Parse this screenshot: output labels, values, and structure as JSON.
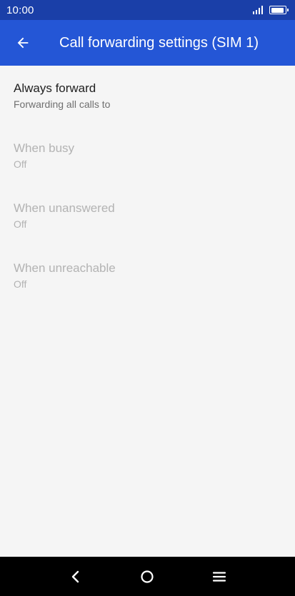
{
  "status_bar": {
    "time": "10:00",
    "icons": [
      "signal-icon",
      "battery-icon"
    ],
    "battery_level": 0.9
  },
  "app_bar": {
    "title": "Call forwarding settings (SIM 1)",
    "back_icon": "arrow-back-icon",
    "background_color": "#2456d6"
  },
  "settings": [
    {
      "title": "Always forward",
      "summary": "Forwarding all calls to",
      "enabled": true
    },
    {
      "title": "When busy",
      "summary": "Off",
      "enabled": false
    },
    {
      "title": "When unanswered",
      "summary": "Off",
      "enabled": false
    },
    {
      "title": "When unreachable",
      "summary": "Off",
      "enabled": false
    }
  ],
  "nav_bar": {
    "buttons": [
      "back-icon",
      "home-icon",
      "menu-icon"
    ]
  }
}
